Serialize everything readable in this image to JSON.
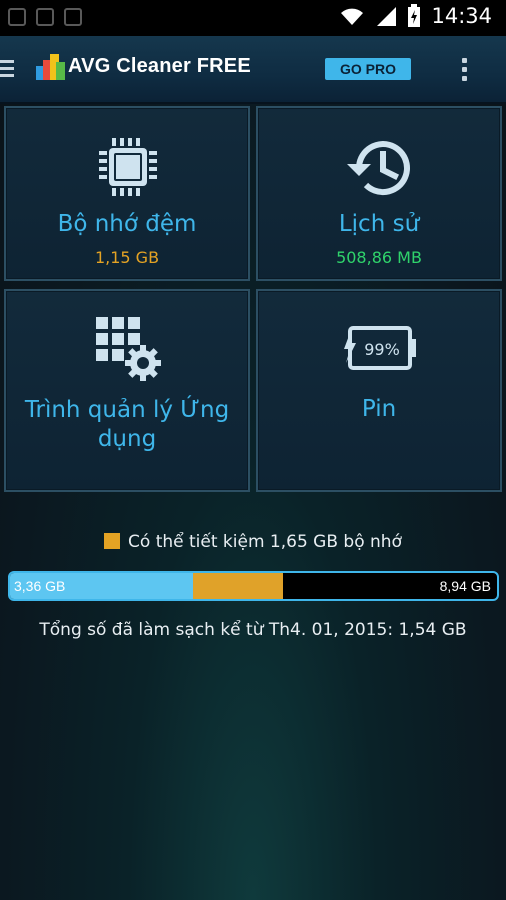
{
  "status_bar": {
    "time": "14:34"
  },
  "header": {
    "app_name": "AVG Cleaner FREE",
    "go_pro_label": "GO PRO"
  },
  "tiles": [
    {
      "label": "Bộ nhớ đệm",
      "value": "1,15 GB",
      "value_color": "#e4a324",
      "icon": "chip-icon"
    },
    {
      "label": "Lịch sử",
      "value": "508,86 MB",
      "value_color": "#2fd36b",
      "icon": "history-icon"
    },
    {
      "label": "Trình quản lý Ứng dụng",
      "label_line1": "Trình quản lý Ứng",
      "label_line2": "dụng",
      "icon": "app-manager-icon"
    },
    {
      "label": "Pin",
      "icon": "battery-icon",
      "battery_text": "99%"
    }
  ],
  "storage": {
    "legend": "Có thể tiết kiệm 1,65 GB bộ nhớ",
    "used_label": "3,36 GB",
    "total_label": "8,94 GB",
    "used_fraction": 0.376,
    "saveable_fraction": 0.185,
    "used_color": "#5dc6f1",
    "saveable_color": "#e0a229"
  },
  "total_cleaned": "Tổng số đã làm sạch kể từ Th4. 01, 2015: 1,54 GB",
  "colors": {
    "accent": "#3fb6ea",
    "background": "#0b1820"
  }
}
